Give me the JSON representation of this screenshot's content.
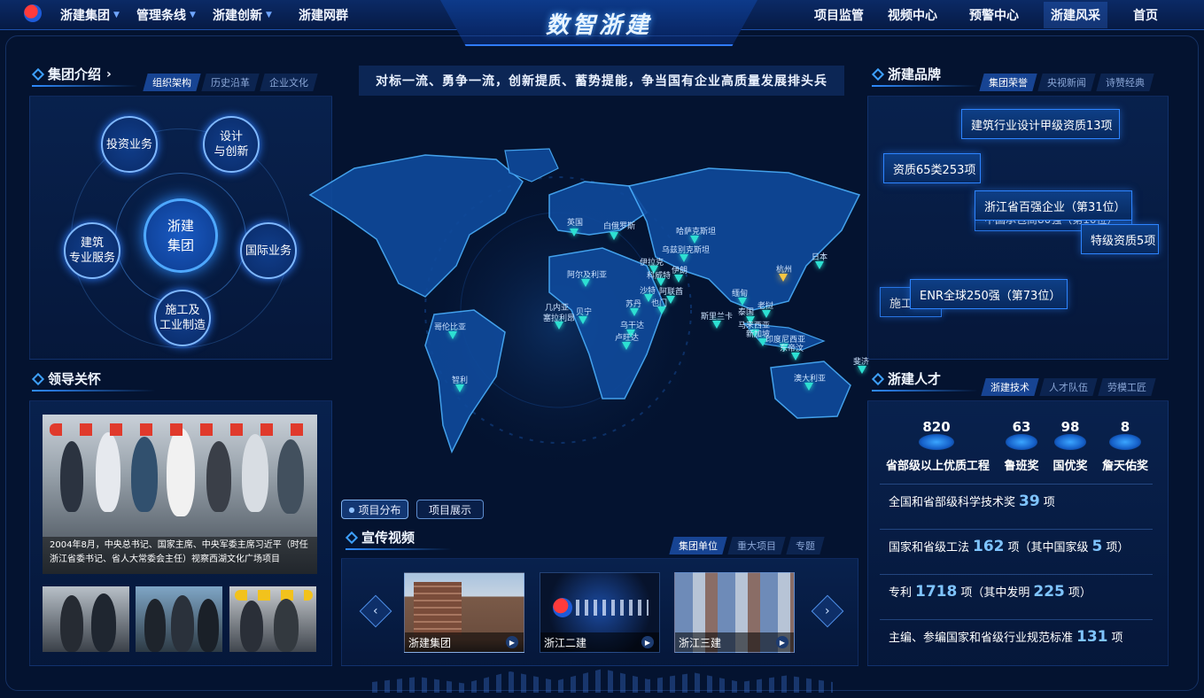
{
  "header": {
    "title": "数智浙建",
    "nav_left": [
      {
        "label": "浙建集团"
      },
      {
        "label": "管理条线"
      },
      {
        "label": "浙建创新"
      },
      {
        "label": "浙建网群"
      }
    ],
    "nav_right": [
      {
        "label": "项目监管"
      },
      {
        "label": "视频中心"
      },
      {
        "label": "预警中心"
      },
      {
        "label": "浙建风采",
        "active": true
      },
      {
        "label": "首页"
      }
    ]
  },
  "group_intro": {
    "title": "集团介绍",
    "tabs": [
      "组织架构",
      "历史沿革",
      "企业文化"
    ],
    "active_tab": "组织架构",
    "center": "浙建\n集团",
    "nodes": [
      "投资业务",
      "设计\n与创新",
      "国际业务",
      "施工及\n工业制造",
      "建筑\n专业服务"
    ]
  },
  "leadership": {
    "title": "领导关怀",
    "caption": "2004年8月，中央总书记、国家主席、中央军委主席习近平（时任浙江省委书记、省人大常委会主任）视察西湖文化广场项目"
  },
  "slogan": "对标一流、勇争一流，创新提质、蓄势提能，争当国有企业高质量发展排头兵",
  "map": {
    "pins": [
      {
        "label": "英国"
      },
      {
        "label": "白俄罗斯"
      },
      {
        "label": "哈萨克斯坦"
      },
      {
        "label": "乌兹别克斯坦"
      },
      {
        "label": "伊拉克"
      },
      {
        "label": "科威特"
      },
      {
        "label": "伊朗"
      },
      {
        "label": "阿尔及利亚"
      },
      {
        "label": "沙特"
      },
      {
        "label": "阿联酋"
      },
      {
        "label": "也门"
      },
      {
        "label": "苏丹"
      },
      {
        "label": "几内亚"
      },
      {
        "label": "塞拉利昂"
      },
      {
        "label": "贝宁"
      },
      {
        "label": "乌干达"
      },
      {
        "label": "卢旺达"
      },
      {
        "label": "哥伦比亚"
      },
      {
        "label": "智利"
      },
      {
        "label": "杭州",
        "hq": true
      },
      {
        "label": "日本"
      },
      {
        "label": "缅甸"
      },
      {
        "label": "老挝"
      },
      {
        "label": "泰国"
      },
      {
        "label": "斯里兰卡"
      },
      {
        "label": "马来西亚"
      },
      {
        "label": "新加坡"
      },
      {
        "label": "印度尼西亚"
      },
      {
        "label": "东帝汶"
      },
      {
        "label": "澳大利亚"
      },
      {
        "label": "斐济"
      }
    ],
    "buttons": [
      "项目分布",
      "项目展示"
    ]
  },
  "promo_video": {
    "title": "宣传视频",
    "tabs": [
      "集团单位",
      "重大项目",
      "专题"
    ],
    "active_tab": "集团单位",
    "videos": [
      {
        "label": "浙建集团"
      },
      {
        "label": "浙江二建"
      },
      {
        "label": "浙江三建"
      }
    ]
  },
  "brand": {
    "title": "浙建品牌",
    "tabs": [
      "集团荣誉",
      "央视新闻",
      "诗赞经典"
    ],
    "active_tab": "集团荣誉",
    "tags": [
      "建筑行业设计甲级资质13项",
      "资质65类253项",
      "中国承包商80强（第10位）",
      "浙江省百强企业（第31位）",
      "特级资质5项",
      "施工总承包",
      "ENR全球250强（第73位）"
    ]
  },
  "talent": {
    "title": "浙建人才",
    "tabs": [
      "浙建技术",
      "人才队伍",
      "劳模工匠"
    ],
    "active_tab": "浙建技术",
    "awards": [
      {
        "value": "820",
        "label": "省部级以上优质工程"
      },
      {
        "value": "63",
        "label": "鲁班奖"
      },
      {
        "value": "98",
        "label": "国优奖"
      },
      {
        "value": "8",
        "label": "詹天佑奖"
      }
    ],
    "stats": [
      {
        "pre": "全国和省部级科学技术奖",
        "n1": "39",
        "mid": "项",
        "n2": "",
        "post": ""
      },
      {
        "pre": "国家和省级工法",
        "n1": "162",
        "mid": "项（其中国家级",
        "n2": "5",
        "post": "项）"
      },
      {
        "pre": "专利",
        "n1": "1718",
        "mid": "项（其中发明",
        "n2": "225",
        "post": "项）"
      },
      {
        "pre": "主编、参编国家和省级行业规范标准",
        "n1": "131",
        "mid": "项",
        "n2": "",
        "post": ""
      }
    ]
  }
}
